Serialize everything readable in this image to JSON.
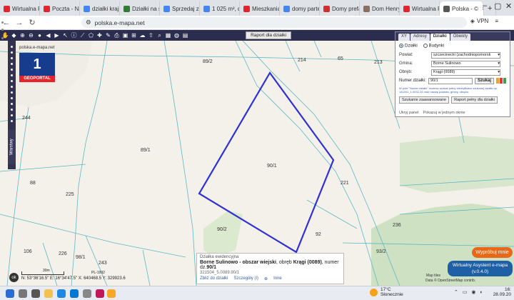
{
  "browser": {
    "tabs": [
      {
        "label": "Wirtualna Po",
        "color": "#e4232c",
        "icon": "wp-icon"
      },
      {
        "label": "Poczta - Naj",
        "color": "#e4232c",
        "icon": "wp-icon"
      },
      {
        "label": "działki kraj",
        "color": "#4285f4",
        "icon": "google-icon"
      },
      {
        "label": "Działki na s",
        "color": "#2e7d32",
        "icon": "doc-icon"
      },
      {
        "label": "Sprzedaj z C",
        "color": "#4285f4",
        "icon": "google-icon"
      },
      {
        "label": "1 025 m², dz",
        "color": "#4285f4",
        "icon": "google-icon"
      },
      {
        "label": "Mieszkania",
        "color": "#e4232c",
        "icon": "tag-icon"
      },
      {
        "label": "domy partei",
        "color": "#4285f4",
        "icon": "google-icon"
      },
      {
        "label": "Domy prefab",
        "color": "#d32f2f",
        "icon": "house-icon"
      },
      {
        "label": "Dom Henryk",
        "color": "#8d6e63",
        "icon": "doc-icon"
      },
      {
        "label": "Wirtualna Pa",
        "color": "#e4232c",
        "icon": "wp-icon"
      },
      {
        "label": "Polska - ©",
        "color": "#555555",
        "icon": "map-icon"
      }
    ],
    "url": "polska.e-mapa.net",
    "vpn_label": "VPN"
  },
  "toolbar": {
    "raport_label": "Raport dla działki"
  },
  "logo": {
    "site": "polska.e-mapa.net",
    "number": "1",
    "name": "GEOPORTAL"
  },
  "side": {
    "warstwy": "Warstwy"
  },
  "map": {
    "labels": [
      {
        "text": "89/2"
      },
      {
        "text": "214"
      },
      {
        "text": "65"
      },
      {
        "text": "213"
      },
      {
        "text": "244"
      },
      {
        "text": "89/1"
      },
      {
        "text": "90/1"
      },
      {
        "text": "88"
      },
      {
        "text": "225"
      },
      {
        "text": "221"
      },
      {
        "text": "236"
      },
      {
        "text": "90/2"
      },
      {
        "text": "92"
      },
      {
        "text": "93/2"
      },
      {
        "text": "106"
      },
      {
        "text": "226"
      },
      {
        "text": "98/1"
      },
      {
        "text": "243"
      }
    ]
  },
  "panel": {
    "tabs": [
      "XY",
      "Adresy",
      "Działki",
      "Obiekty"
    ],
    "active_tab": "Działki",
    "radio": [
      "Działki",
      "Budynki"
    ],
    "powiat_label": "Powiat:",
    "powiat_value": "szczecinecki (zachodniopomorsk",
    "gmina_label": "Gmina:",
    "gmina_value": "Borne Sulinowo",
    "obreb_label": "Obręb:",
    "obreb_value": "Krągi (0089)",
    "numer_label": "Numer działki:",
    "numer_value": "90/1",
    "szukaj_label": "Szukaj",
    "hint": "W pole \"Numer działki\" możesz wpisać pełny identyfikator szukanej działki np. 141201_1.0032.24 oraz nazwę powiatu, gminy, obrębu.",
    "szukanie_label": "Szukanie zaawansowane",
    "raport_pelny_label": "Raport pełny dla działki",
    "foot_left": "Ukryj panel",
    "foot_right": "Pokazuj w jednym oknie"
  },
  "info": {
    "title": "Działka ewidencyjna",
    "line_main": "Borne Sulinowo - obszar wiejski",
    "line_mid": ", obręb ",
    "obreb": "Krągi (0089)",
    "line_num": ", numer dz.",
    "numer": "90/1",
    "id": "321504_5.0089.90/1",
    "link1": "Zbliż do działki",
    "link2": "Szczegóły (I)",
    "link3": "Inne"
  },
  "scale": {
    "value": "30m",
    "proj": "PL-1992",
    "coords": "N: 53°36'16.5\"  E: 16°34'47.5\"  X: 640468.5  Y: 329923.6",
    "ok_label": "ok"
  },
  "assistant": {
    "try_label": "Wypróbuj mnie",
    "title": "Wirtualny Asystent e-mapa",
    "version": "(v.0.4.0)",
    "attribution1": "Map tiles",
    "attribution2": "Data © OpenStreetMap contrib."
  },
  "taskbar": {
    "temp": "17°C",
    "weather": "Słonecznie",
    "time": "16:",
    "date": "28.09.20"
  },
  "colors": {
    "parcel_outline": "#3030d8",
    "toolbar_bg": "#2c2c4e",
    "logo_blue": "#173c8e",
    "logo_red": "#e4232c",
    "cadastral_lines": "#5db7c5"
  }
}
